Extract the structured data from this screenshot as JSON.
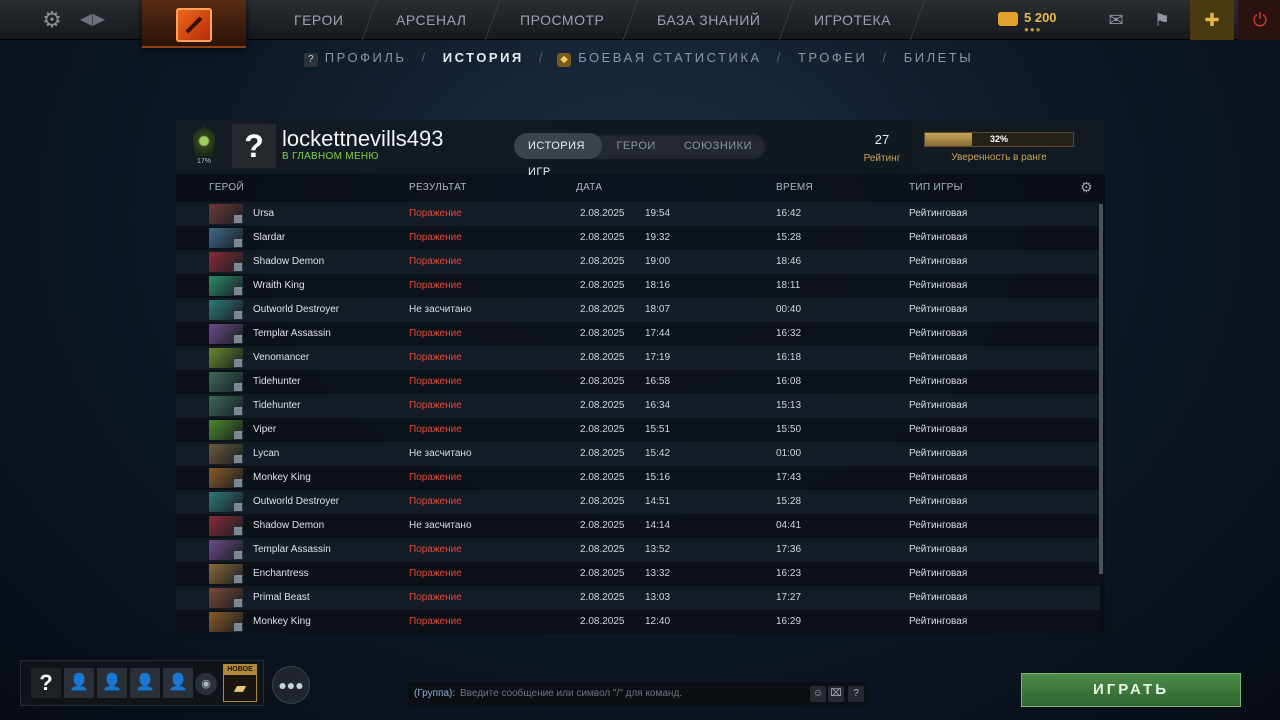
{
  "topbar": {
    "nav": [
      "ГЕРОИ",
      "АРСЕНАЛ",
      "ПРОСМОТР",
      "БАЗА ЗНАНИЙ",
      "ИГРОТЕКА"
    ],
    "currency_amount": "5 200",
    "colors": {
      "accent_gold": "#e8b94a",
      "power_red": "#d63a2a"
    }
  },
  "subnav": {
    "profile": "ПРОФИЛЬ",
    "history": "ИСТОРИЯ",
    "battle_stats": "БОЕВАЯ СТАТИСТИКА",
    "trophies": "ТРОФЕИ",
    "tickets": "БИЛЕТЫ",
    "separator": "/"
  },
  "profile": {
    "avatar_text": "?",
    "username": "lockettnevills493",
    "status": "В ГЛАВНОМ МЕНЮ",
    "rank_percent": "17%",
    "rating_value": "27",
    "rating_label": "Рейтинг",
    "confidence_value": "32%",
    "confidence_fraction": 0.32,
    "confidence_label": "Уверенность в ранге"
  },
  "tabs": [
    "ИСТОРИЯ ИГР",
    "ГЕРОИ",
    "СОЮЗНИКИ"
  ],
  "table": {
    "headers": {
      "hero": "ГЕРОЙ",
      "result": "РЕЗУЛЬТАТ",
      "date": "ДАТА",
      "duration": "ВРЕМЯ",
      "type": "ТИП ИГРЫ"
    },
    "rows": [
      {
        "hero": "Ursa",
        "result": "Поражение",
        "date": "2.08.2025",
        "time": "19:54",
        "duration": "16:42",
        "type": "Рейтинговая",
        "loss": true,
        "color": "#6b3a3a"
      },
      {
        "hero": "Slardar",
        "result": "Поражение",
        "date": "2.08.2025",
        "time": "19:32",
        "duration": "15:28",
        "type": "Рейтинговая",
        "loss": true,
        "color": "#3e6a8a"
      },
      {
        "hero": "Shadow Demon",
        "result": "Поражение",
        "date": "2.08.2025",
        "time": "19:00",
        "duration": "18:46",
        "type": "Рейтинговая",
        "loss": true,
        "color": "#8a2a3a"
      },
      {
        "hero": "Wraith King",
        "result": "Поражение",
        "date": "2.08.2025",
        "time": "18:16",
        "duration": "18:11",
        "type": "Рейтинговая",
        "loss": true,
        "color": "#2e8a6a"
      },
      {
        "hero": "Outworld Destroyer",
        "result": "Не засчитано",
        "date": "2.08.2025",
        "time": "18:07",
        "duration": "00:40",
        "type": "Рейтинговая",
        "loss": false,
        "color": "#2e7a7a"
      },
      {
        "hero": "Templar Assassin",
        "result": "Поражение",
        "date": "2.08.2025",
        "time": "17:44",
        "duration": "16:32",
        "type": "Рейтинговая",
        "loss": true,
        "color": "#6a4a8a"
      },
      {
        "hero": "Venomancer",
        "result": "Поражение",
        "date": "2.08.2025",
        "time": "17:19",
        "duration": "16:18",
        "type": "Рейтинговая",
        "loss": true,
        "color": "#6a8a2e"
      },
      {
        "hero": "Tidehunter",
        "result": "Поражение",
        "date": "2.08.2025",
        "time": "16:58",
        "duration": "16:08",
        "type": "Рейтинговая",
        "loss": true,
        "color": "#3a6a5a"
      },
      {
        "hero": "Tidehunter",
        "result": "Поражение",
        "date": "2.08.2025",
        "time": "16:34",
        "duration": "15:13",
        "type": "Рейтинговая",
        "loss": true,
        "color": "#3a6a5a"
      },
      {
        "hero": "Viper",
        "result": "Поражение",
        "date": "2.08.2025",
        "time": "15:51",
        "duration": "15:50",
        "type": "Рейтинговая",
        "loss": true,
        "color": "#4a8a2a"
      },
      {
        "hero": "Lycan",
        "result": "Не засчитано",
        "date": "2.08.2025",
        "time": "15:42",
        "duration": "01:00",
        "type": "Рейтинговая",
        "loss": false,
        "color": "#6a5a3a"
      },
      {
        "hero": "Monkey King",
        "result": "Поражение",
        "date": "2.08.2025",
        "time": "15:16",
        "duration": "17:43",
        "type": "Рейтинговая",
        "loss": true,
        "color": "#8a5a2a"
      },
      {
        "hero": "Outworld Destroyer",
        "result": "Поражение",
        "date": "2.08.2025",
        "time": "14:51",
        "duration": "15:28",
        "type": "Рейтинговая",
        "loss": true,
        "color": "#2e7a7a"
      },
      {
        "hero": "Shadow Demon",
        "result": "Не засчитано",
        "date": "2.08.2025",
        "time": "14:14",
        "duration": "04:41",
        "type": "Рейтинговая",
        "loss": false,
        "color": "#8a2a3a"
      },
      {
        "hero": "Templar Assassin",
        "result": "Поражение",
        "date": "2.08.2025",
        "time": "13:52",
        "duration": "17:36",
        "type": "Рейтинговая",
        "loss": true,
        "color": "#6a4a8a"
      },
      {
        "hero": "Enchantress",
        "result": "Поражение",
        "date": "2.08.2025",
        "time": "13:32",
        "duration": "16:23",
        "type": "Рейтинговая",
        "loss": true,
        "color": "#8a6a3a"
      },
      {
        "hero": "Primal Beast",
        "result": "Поражение",
        "date": "2.08.2025",
        "time": "13:03",
        "duration": "17:27",
        "type": "Рейтинговая",
        "loss": true,
        "color": "#7a4a3a"
      },
      {
        "hero": "Monkey King",
        "result": "Поражение",
        "date": "2.08.2025",
        "time": "12:40",
        "duration": "16:29",
        "type": "Рейтинговая",
        "loss": true,
        "color": "#8a5a2a"
      }
    ]
  },
  "bottom": {
    "new_tag": "НОВОЕ",
    "chat_group": "(Группа):",
    "chat_placeholder": "Введите сообщение или символ \"/\" для команд.",
    "play_label": "ИГРАТЬ",
    "me_slot": "?",
    "help": "?"
  }
}
